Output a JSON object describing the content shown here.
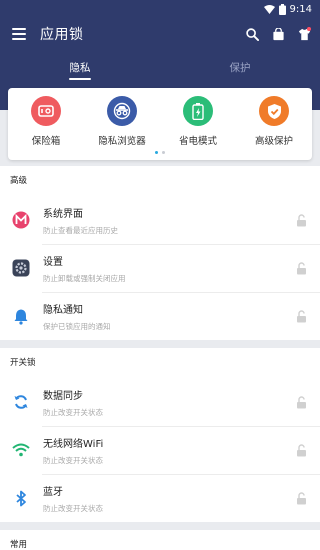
{
  "status_bar": {
    "time": "9:14",
    "icons": [
      "wifi-icon",
      "battery-icon"
    ]
  },
  "app_bar": {
    "title": "应用锁",
    "icons": [
      "menu-icon",
      "search-icon",
      "shopping-bag-icon",
      "shirt-icon"
    ]
  },
  "tabs": [
    {
      "label": "隐私",
      "active": true
    },
    {
      "label": "保护",
      "active": false
    }
  ],
  "features": [
    {
      "label": "保险箱",
      "icon": "vault-icon",
      "color": "#ef5b5f"
    },
    {
      "label": "隐私浏览器",
      "icon": "incognito-browser-icon",
      "color": "#3b5ba8"
    },
    {
      "label": "省电模式",
      "icon": "battery-saver-icon",
      "color": "#2bbd78"
    },
    {
      "label": "高级保护",
      "icon": "shield-icon",
      "color": "#f07b29"
    }
  ],
  "pager": {
    "current": 1,
    "total": 2
  },
  "sections": [
    {
      "title": "高级",
      "items": [
        {
          "title": "系统界面",
          "subtitle": "防止查看最近应用历史",
          "icon": "system-ui-icon"
        },
        {
          "title": "设置",
          "subtitle": "防止卸载或强制关闭应用",
          "icon": "settings-icon"
        },
        {
          "title": "隐私通知",
          "subtitle": "保护已锁应用的通知",
          "icon": "bell-icon"
        }
      ]
    },
    {
      "title": "开关锁",
      "items": [
        {
          "title": "数据同步",
          "subtitle": "防止改变开关状态",
          "icon": "sync-icon"
        },
        {
          "title": "无线网络WiFi",
          "subtitle": "防止改变开关状态",
          "icon": "wifi-icon"
        },
        {
          "title": "蓝牙",
          "subtitle": "防止改变开关状态",
          "icon": "bluetooth-icon"
        }
      ]
    },
    {
      "title": "常用",
      "items": []
    }
  ],
  "colors": {
    "header": "#2f3b6c",
    "accent": "#29a9df",
    "background": "#e9ebef"
  }
}
